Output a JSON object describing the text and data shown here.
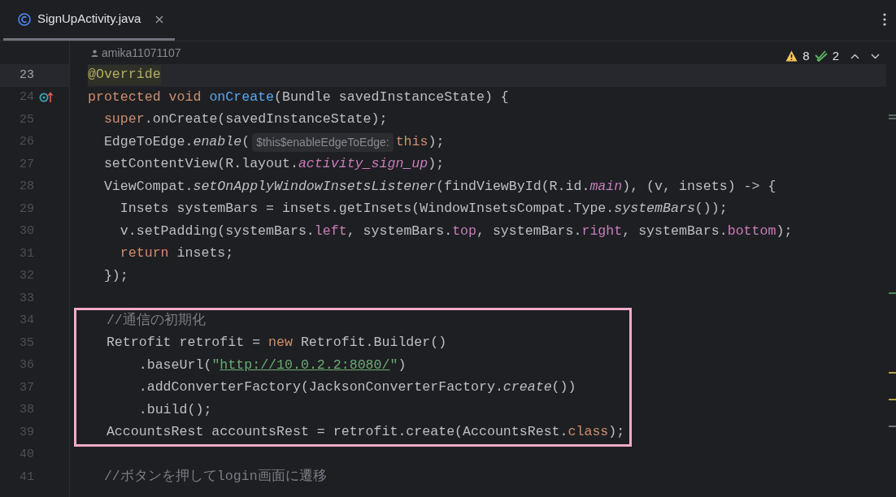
{
  "tab": {
    "title": "SignUpActivity.java",
    "selected": true
  },
  "author": "amika11071107",
  "inspections": {
    "warnings": "8",
    "weak_warnings": "2"
  },
  "lines_before": [
    {
      "number": "23",
      "current": true,
      "override": false,
      "tokens": [
        {
          "kind": "annotation",
          "text": "@Override"
        }
      ]
    },
    {
      "number": "24",
      "current": false,
      "override": true,
      "tokens": [
        {
          "kind": "keyword",
          "text": "protected void "
        },
        {
          "kind": "method_decl",
          "text": "onCreate"
        },
        {
          "kind": "plain",
          "text": "(Bundle savedInstanceState) {"
        }
      ]
    },
    {
      "number": "25",
      "current": false,
      "override": false,
      "tokens": [
        {
          "kind": "keyword",
          "text": "  super"
        },
        {
          "kind": "plain",
          "text": ".onCreate(savedInstanceState);"
        }
      ]
    },
    {
      "number": "26",
      "current": false,
      "override": false,
      "tokens": [
        {
          "kind": "plain",
          "text": "  EdgeToEdge."
        },
        {
          "kind": "italic",
          "text": "enable"
        },
        {
          "kind": "plain",
          "text": "("
        },
        {
          "kind": "hint",
          "text": "$this$enableEdgeToEdge:"
        },
        {
          "kind": "keyword",
          "text": "this"
        },
        {
          "kind": "plain",
          "text": ");"
        }
      ]
    },
    {
      "number": "27",
      "current": false,
      "override": false,
      "tokens": [
        {
          "kind": "plain",
          "text": "  setContentView(R.layout."
        },
        {
          "kind": "field_italic",
          "text": "activity_sign_up"
        },
        {
          "kind": "plain",
          "text": ");"
        }
      ]
    },
    {
      "number": "28",
      "current": false,
      "override": false,
      "tokens": [
        {
          "kind": "plain",
          "text": "  ViewCompat."
        },
        {
          "kind": "italic",
          "text": "setOnApplyWindowInsetsListener"
        },
        {
          "kind": "plain",
          "text": "(findViewById(R.id."
        },
        {
          "kind": "field_italic",
          "text": "main"
        },
        {
          "kind": "plain",
          "text": "), (v, insets) -> {"
        }
      ]
    },
    {
      "number": "29",
      "current": false,
      "override": false,
      "tokens": [
        {
          "kind": "plain",
          "text": "    Insets systemBars = insets.getInsets(WindowInsetsCompat.Type."
        },
        {
          "kind": "italic",
          "text": "systemBars"
        },
        {
          "kind": "plain",
          "text": "());"
        }
      ]
    },
    {
      "number": "30",
      "current": false,
      "override": false,
      "tokens": [
        {
          "kind": "plain",
          "text": "    v.setPadding(systemBars."
        },
        {
          "kind": "field",
          "text": "left"
        },
        {
          "kind": "plain",
          "text": ", systemBars."
        },
        {
          "kind": "field",
          "text": "top"
        },
        {
          "kind": "plain",
          "text": ", systemBars."
        },
        {
          "kind": "field",
          "text": "right"
        },
        {
          "kind": "plain",
          "text": ", systemBars."
        },
        {
          "kind": "field",
          "text": "bottom"
        },
        {
          "kind": "plain",
          "text": ");"
        }
      ]
    },
    {
      "number": "31",
      "current": false,
      "override": false,
      "tokens": [
        {
          "kind": "keyword",
          "text": "    return"
        },
        {
          "kind": "plain",
          "text": " insets;"
        }
      ]
    },
    {
      "number": "32",
      "current": false,
      "override": false,
      "tokens": [
        {
          "kind": "plain",
          "text": "  });"
        }
      ]
    },
    {
      "number": "33",
      "current": false,
      "override": false
    }
  ],
  "highlight_frame": {
    "lines": [
      {
        "number": "34",
        "current": false,
        "override": false,
        "tokens": [
          {
            "kind": "comment",
            "text": "  //通信の初期化"
          }
        ]
      },
      {
        "number": "35",
        "current": false,
        "override": false,
        "tokens": [
          {
            "kind": "plain",
            "text": "  Retrofit retrofit = "
          },
          {
            "kind": "keyword",
            "text": "new"
          },
          {
            "kind": "plain",
            "text": " Retrofit.Builder()"
          }
        ]
      },
      {
        "number": "36",
        "current": false,
        "override": false,
        "tokens": [
          {
            "kind": "plain",
            "text": "      .baseUrl("
          },
          {
            "kind": "string",
            "text": "\""
          },
          {
            "kind": "url",
            "text": "http://10.0.2.2:8080/"
          },
          {
            "kind": "string",
            "text": "\""
          },
          {
            "kind": "plain",
            "text": ")"
          }
        ]
      },
      {
        "number": "37",
        "current": false,
        "override": false,
        "tokens": [
          {
            "kind": "plain",
            "text": "      .addConverterFactory(JacksonConverterFactory."
          },
          {
            "kind": "italic",
            "text": "create"
          },
          {
            "kind": "plain",
            "text": "())"
          }
        ]
      },
      {
        "number": "38",
        "current": false,
        "override": false,
        "tokens": [
          {
            "kind": "plain",
            "text": "      .build();"
          }
        ]
      },
      {
        "number": "39",
        "current": false,
        "override": false,
        "tokens": [
          {
            "kind": "plain",
            "text": "  AccountsRest accountsRest = retrofit.create(AccountsRest."
          },
          {
            "kind": "keyword",
            "text": "class"
          },
          {
            "kind": "plain",
            "text": ");"
          }
        ]
      }
    ]
  },
  "lines_after": [
    {
      "number": "40",
      "current": false,
      "override": false
    },
    {
      "number": "41",
      "current": false,
      "override": false,
      "tokens": [
        {
          "kind": "comment",
          "text": "  //ボタンを押してlogin画面に遷移"
        }
      ]
    }
  ]
}
